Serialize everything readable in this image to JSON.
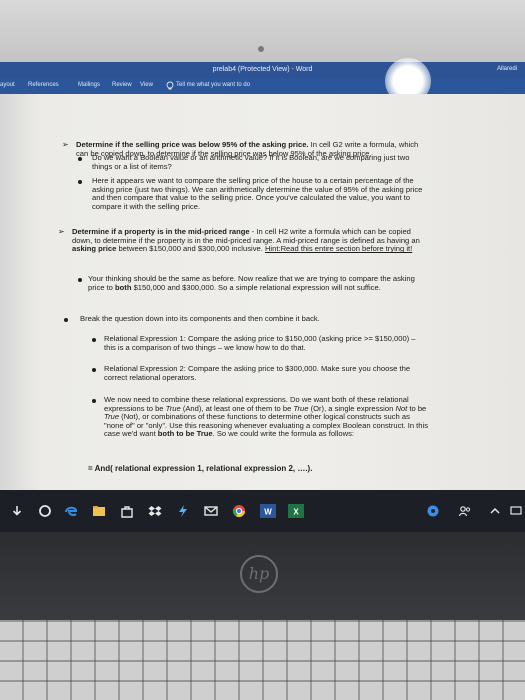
{
  "window": {
    "title": "prelab4 (Protected View)  -  Word",
    "account": "Allaredi"
  },
  "ribbon": {
    "tabs": [
      "ayout",
      "References",
      "Mailings",
      "Review",
      "View"
    ],
    "tell_me": "Tell me what you want to do"
  },
  "document": {
    "p1": {
      "bold": "Determine if the selling price was below 95% of the asking price.",
      "rest": "In cell G2 write a formula, which can be copied down, to determine if the selling price was below 95% of the asking price."
    },
    "p1_b1": "Do we want a Boolean value or an arithmetic value? If it is Boolean, are we comparing just two things or a list of items?",
    "p1_b2": "Here it appears we want to compare the selling price of the house to a certain percentage of the asking price (just two things). We can arithmetically determine the value of 95% of the asking price and then compare that value to the selling price. Once you've calculated the value, you want to compare it with the selling price.",
    "p2": {
      "bold": "Determine if a property is in the mid-priced range",
      "mid": " - In cell H2 write a formula which can be copied down, to determine if the property is in the mid-priced range. A mid-priced range is defined as having an ",
      "bold2": "asking price",
      "mid2": " between $150,000 and $300,000 inclusive. ",
      "link": "Hint:Read this entire section before trying it!"
    },
    "p2_b1": {
      "start": "Your thinking should be the same as before. Now realize that we are trying to compare the asking price to ",
      "bold": "both",
      "end": " $150,000 and $300,000. So a simple relational expression will not suffice."
    },
    "p2_b2": "Break the question down into its components and then combine it back.",
    "p2_b2_s1": "Relational Expression 1: Compare the asking price to $150,000 (asking price >= $150,000) – this is a comparison of two things – we know how to do that.",
    "p2_b2_s2": "Relational Expression 2: Compare the asking price to $300,000. Make sure you choose the correct relational operators.",
    "p2_b2_s3": {
      "a": "We now need to combine these relational expressions. Do we want both of these relational expressions to be ",
      "b": "True",
      "c": " (And), at least one of them to be ",
      "d": "True",
      "e": " (Or), a single expression ",
      "f": "Not",
      "g": " to be ",
      "h": "True",
      "i": " (Not), or combinations of these functions to determine other logical constructs such as \"none of\" or \"only\". Use this reasoning whenever evaluating a complex Boolean construct. In this case we'd want ",
      "j": "both to be True",
      "k": ". So we could write the formula as follows:"
    },
    "formula": "= And( relational expression 1, relational expression 2, ….)."
  },
  "taskbar": {
    "icons": [
      "download-icon",
      "cortana-icon",
      "edge-icon",
      "file-explorer-icon",
      "store-icon",
      "dropbox-icon",
      "bolt-icon",
      "mail-icon",
      "chrome-icon",
      "word-icon",
      "excel-icon",
      "settings-icon",
      "people-icon",
      "chevron-up-icon"
    ]
  },
  "colors": {
    "title_bar": "#2e5395",
    "ribbon": "#2b579a",
    "link": "#1f4fb0"
  }
}
